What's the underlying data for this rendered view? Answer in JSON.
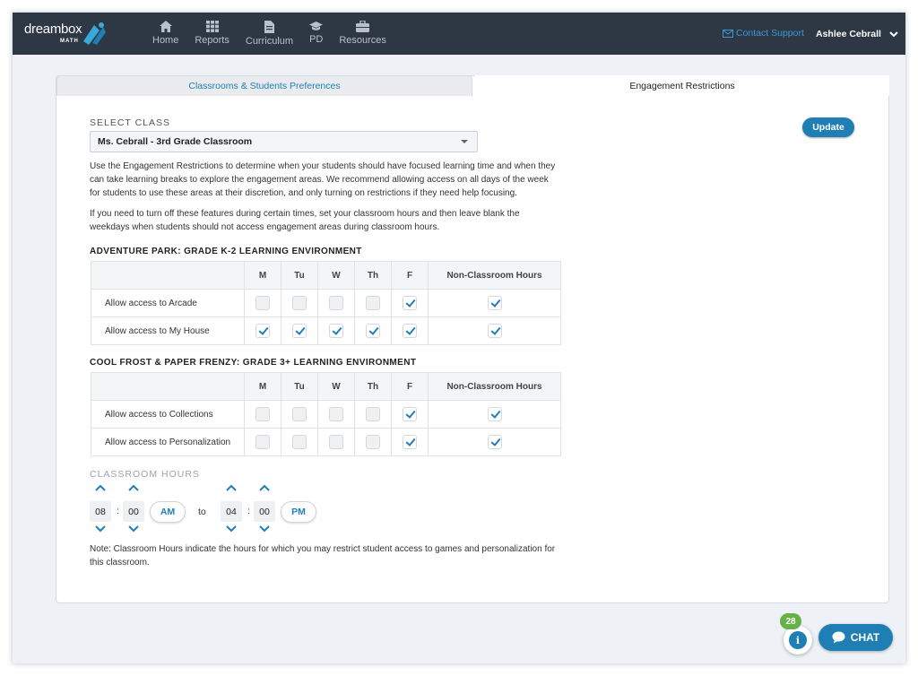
{
  "brand": {
    "word": "dreambox",
    "sub": "MATH"
  },
  "nav": [
    {
      "label": "Home",
      "icon": "home-icon"
    },
    {
      "label": "Reports",
      "icon": "grid-icon"
    },
    {
      "label": "Curriculum",
      "icon": "document-icon"
    },
    {
      "label": "PD",
      "icon": "graduation-cap-icon"
    },
    {
      "label": "Resources",
      "icon": "briefcase-icon"
    }
  ],
  "header": {
    "support": "Contact Support",
    "user": "Ashlee Cebrall"
  },
  "tabs": {
    "left": "Classrooms & Students Preferences",
    "right": "Engagement Restrictions"
  },
  "select_class": {
    "label": "SELECT CLASS",
    "value": "Ms. Cebrall - 3rd Grade Classroom"
  },
  "update_label": "Update",
  "intro": [
    "Use the Engagement Restrictions to determine when your students should have focused learning time and when they can take learning breaks to explore the engagement areas. We recommend allowing access on all days of the week for students to use these areas at their discretion, and only turning on restrictions if they need help focusing.",
    "If you need to turn off these features during certain times, set your classroom hours and then leave blank the weekdays when students should not access engagement areas during classroom hours."
  ],
  "columns": [
    "M",
    "Tu",
    "W",
    "Th",
    "F",
    "Non-Classroom Hours"
  ],
  "sections": [
    {
      "title": "ADVENTURE PARK: GRADE K-2 LEARNING ENVIRONMENT",
      "rows": [
        {
          "label": "Allow access to Arcade",
          "checks": [
            false,
            false,
            false,
            false,
            true,
            true
          ]
        },
        {
          "label": "Allow access to My House",
          "checks": [
            true,
            true,
            true,
            true,
            true,
            true
          ]
        }
      ]
    },
    {
      "title": "COOL FROST & PAPER FRENZY: GRADE 3+ LEARNING ENVIRONMENT",
      "rows": [
        {
          "label": "Allow access to Collections",
          "checks": [
            false,
            false,
            false,
            false,
            true,
            true
          ]
        },
        {
          "label": "Allow access to Personalization",
          "checks": [
            false,
            false,
            false,
            false,
            true,
            true
          ]
        }
      ]
    }
  ],
  "classroom_hours": {
    "label": "CLASSROOM HOURS",
    "start_hour": "08",
    "start_min": "00",
    "start_period": "AM",
    "to": "to",
    "end_hour": "04",
    "end_min": "00",
    "end_period": "PM"
  },
  "note": "Note: Classroom Hours indicate the hours for which you may restrict student access to games and personalization for this classroom.",
  "badge_count": "28",
  "info_glyph": "i",
  "chat_label": "CHAT",
  "colors": {
    "accent": "#1f7fb5",
    "topbar": "#2e3744",
    "badge": "#66b246"
  }
}
